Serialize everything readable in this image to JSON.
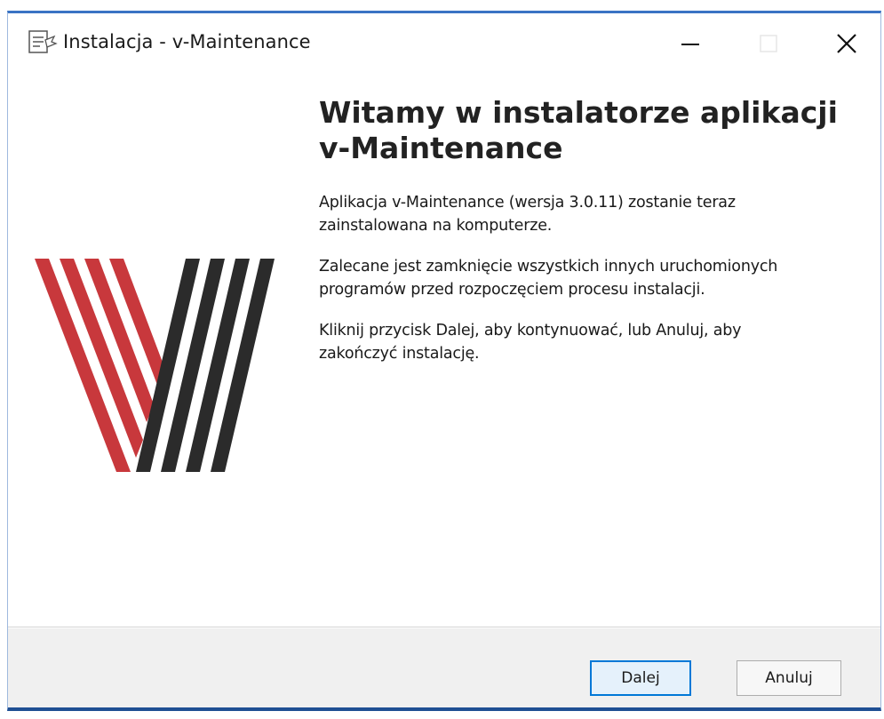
{
  "window": {
    "title": "Instalacja - v-Maintenance",
    "icon": "installer-icon",
    "controls": {
      "minimize_icon": "minimize-icon",
      "maximize_icon": "maximize-icon",
      "close_icon": "close-icon"
    }
  },
  "logo": {
    "icon": "v-maintenance-logo",
    "colors": {
      "red": "#c8383c",
      "dark": "#2b2b2b"
    }
  },
  "content": {
    "heading_line1": "Witamy w instalatorze aplikacji",
    "heading_line2": "v-Maintenance",
    "paragraph1": "Aplikacja v-Maintenance (wersja 3.0.11) zostanie teraz\nzainstalowana na komputerze.",
    "paragraph2": "Zalecane jest zamknięcie wszystkich innych uruchomionych\nprogramów przed rozpoczęciem procesu instalacji.",
    "paragraph3": "Kliknij przycisk Dalej, aby kontynuować, lub Anuluj, aby\nzakończyć instalację."
  },
  "footer": {
    "next_label": "Dalej",
    "cancel_label": "Anuluj"
  },
  "colors": {
    "accent": "#0078d7",
    "window_border": "#3a73c4"
  }
}
